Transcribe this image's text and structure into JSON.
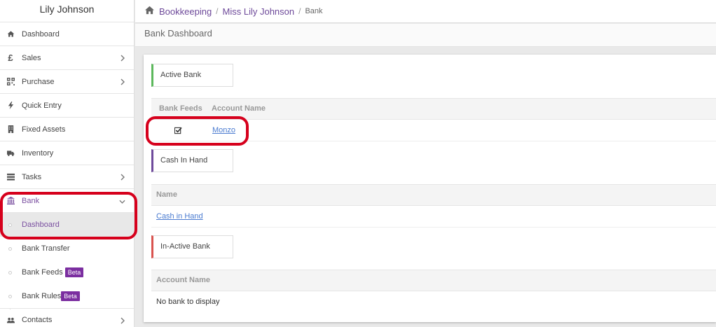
{
  "sidebar": {
    "user_name": "Lily Johnson",
    "items": [
      {
        "label": "Dashboard",
        "icon": "home-icon"
      },
      {
        "label": "Sales",
        "icon": "pound-icon"
      },
      {
        "label": "Purchase",
        "icon": "qr-icon"
      },
      {
        "label": "Quick Entry",
        "icon": "bolt-icon"
      },
      {
        "label": "Fixed Assets",
        "icon": "building-icon"
      },
      {
        "label": "Inventory",
        "icon": "truck-icon"
      },
      {
        "label": "Tasks",
        "icon": "tasks-icon"
      },
      {
        "label": "Bank",
        "icon": "bank-icon"
      },
      {
        "label": "Contacts",
        "icon": "users-icon"
      }
    ],
    "bank_sub": [
      {
        "label": "Dashboard"
      },
      {
        "label": "Bank Transfer"
      },
      {
        "label": "Bank Feeds",
        "badge": "Beta"
      },
      {
        "label": "Bank Rules",
        "badge": "Beta"
      }
    ]
  },
  "breadcrumb": {
    "items": [
      "Bookkeeping",
      "Miss Lily Johnson"
    ],
    "separator": "/",
    "current": "Bank"
  },
  "page": {
    "title": "Bank Dashboard"
  },
  "active_bank": {
    "label": "Active Bank",
    "columns": [
      "Bank Feeds",
      "Account Name"
    ],
    "rows": [
      {
        "bank_feeds_checked": true,
        "account_name": "Monzo"
      }
    ]
  },
  "cash_in_hand": {
    "label": "Cash In Hand",
    "columns": [
      "Name"
    ],
    "rows": [
      {
        "name": "Cash in Hand"
      }
    ]
  },
  "inactive_bank": {
    "label": "In-Active Bank",
    "columns": [
      "Account Name"
    ],
    "empty_text": "No bank to display"
  },
  "colors": {
    "accent": "#6f4a9c",
    "active_green": "#5cb85c",
    "inactive_red": "#d9534f",
    "highlight": "#d6001c",
    "beta_badge": "#7b2ea0"
  }
}
